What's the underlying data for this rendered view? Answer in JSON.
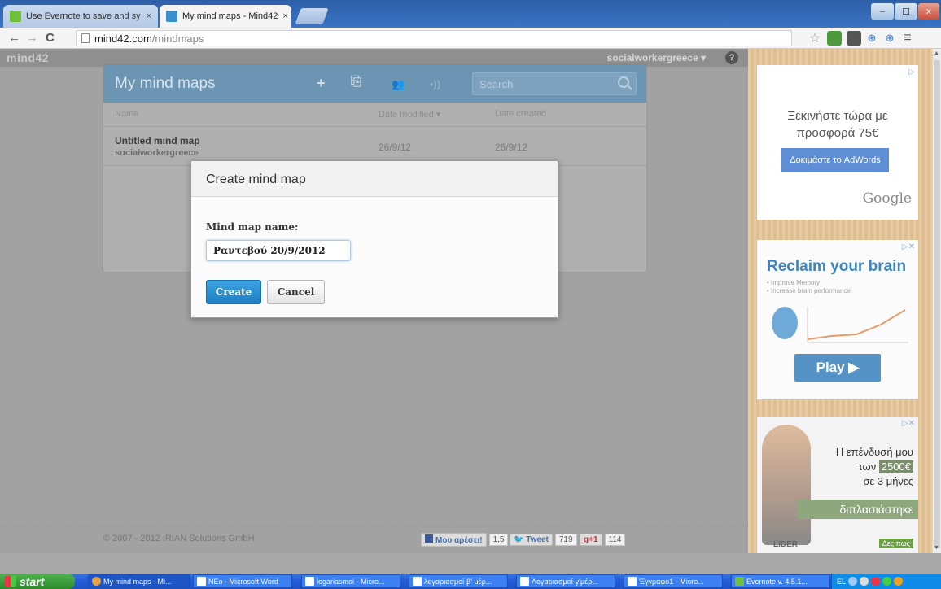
{
  "browser": {
    "tabs": [
      {
        "label": "Use Evernote to save and sy",
        "active": false
      },
      {
        "label": "My mind maps - Mind42",
        "active": true
      }
    ],
    "tab_close": "×",
    "window_controls": {
      "minimize": "–",
      "maximize": "☐",
      "close": "x"
    },
    "url_host": "mind42.com",
    "url_path": "/mindmaps"
  },
  "app": {
    "logo": "mind42",
    "user": "socialworkergreece ▾",
    "help": "?",
    "panel_title": "My mind maps",
    "toolbar_icons": [
      "plus-icon",
      "import-icon",
      "share-icon",
      "broadcast-icon"
    ],
    "toolbar_glyphs": {
      "add": "+",
      "import": "⎘",
      "share": "👥",
      "broadcast": "•))"
    },
    "search_placeholder": "Search",
    "columns": {
      "name": "Name",
      "modified": "Date modified ▾",
      "created": "Date created"
    },
    "maps": [
      {
        "name": "Untitled mind map",
        "owner": "socialworkergreece",
        "modified": "26/9/12",
        "created": "26/9/12"
      }
    ]
  },
  "dialog": {
    "title": "Create mind map",
    "name_label": "Mind map name:",
    "name_value": "Ραντεβού 20/9/2012",
    "create_label": "Create",
    "cancel_label": "Cancel"
  },
  "footer": {
    "copyright": "© 2007 - 2012 IRIAN Solutions GmbH",
    "like_label": "Μου αρέσει!",
    "like_count": "1,5",
    "tweet_label": "Tweet",
    "tweet_count": "719",
    "gplus_label": "+1",
    "gplus_count": "114"
  },
  "ads": {
    "ad1": {
      "choice": "▷",
      "text_line1": "Ξεκινήστε τώρα με",
      "text_line2": "προσφορά 75€",
      "button": "Δοκιμάστε το AdWords",
      "brand": "Google"
    },
    "ad2": {
      "choice": "▷✕",
      "headline": "Reclaim your brain",
      "bullet1": "• Improve Memory",
      "bullet2": "• Increase brain performance",
      "button": "Play ▶"
    },
    "ad3": {
      "choice": "▷✕",
      "line1": "Η επένδυσή μου",
      "line2_prefix": "των",
      "amount": "2500€",
      "line3": "σε 3 μήνες",
      "band": "διπλασιάστηκε",
      "brand": "LIDER",
      "cta": "Δες πως"
    }
  },
  "taskbar": {
    "start": "start",
    "tasks": [
      "My mind maps - Mi...",
      "NEo - Microsoft Word",
      "logariasmoi - Micro...",
      "λογαριασμοί-β' μέρ...",
      "Λογαριασμοί-γ'μέρ...",
      "Έγγραφο1 - Micro...",
      "Evernote v. 4.5.1..."
    ],
    "lang": "EL"
  },
  "colors": {
    "panel_header": "#6c95b4",
    "create_button": "#1f7fc4",
    "ad_background": "#e7c79a",
    "taskbar": "#245edb"
  }
}
